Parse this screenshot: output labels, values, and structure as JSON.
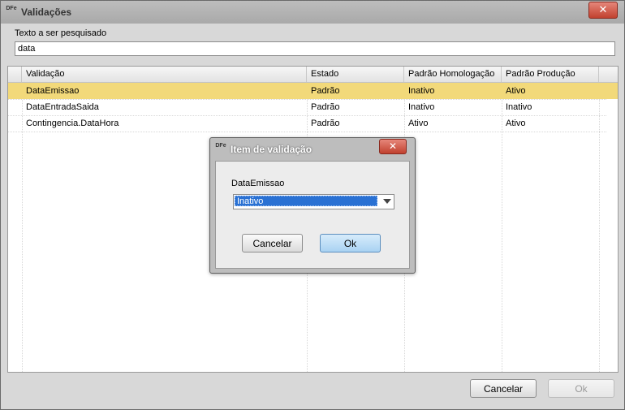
{
  "window": {
    "app_icon_text": "DFe",
    "title": "Validações",
    "close_glyph": "✕"
  },
  "search": {
    "label": "Texto a ser pesquisado",
    "value": "data"
  },
  "table": {
    "columns": [
      "Validação",
      "Estado",
      "Padrão Homologação",
      "Padrão Produção"
    ],
    "rows": [
      {
        "validacao": "DataEmissao",
        "estado": "Padrão",
        "homologacao": "Inativo",
        "producao": "Ativo",
        "selected": true
      },
      {
        "validacao": "DataEntradaSaida",
        "estado": "Padrão",
        "homologacao": "Inativo",
        "producao": "Inativo",
        "selected": false
      },
      {
        "validacao": "Contingencia.DataHora",
        "estado": "Padrão",
        "homologacao": "Ativo",
        "producao": "Ativo",
        "selected": false
      }
    ]
  },
  "footer": {
    "cancel_label": "Cancelar",
    "ok_label": "Ok"
  },
  "dialog": {
    "title": "Item de validação",
    "close_glyph": "✕",
    "field_label": "DataEmissao",
    "select_value": "Inativo",
    "cancel_label": "Cancelar",
    "ok_label": "Ok"
  },
  "colors": {
    "selected_row": "#f2d97a",
    "accent_blue": "#2a71d3",
    "close_red": "#c1412f"
  }
}
